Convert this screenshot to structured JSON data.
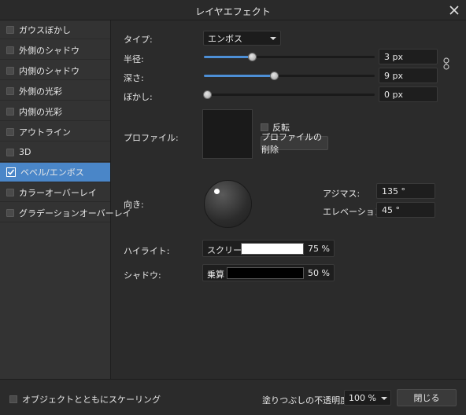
{
  "window": {
    "title": "レイヤエフェクト"
  },
  "sidebar": {
    "items": [
      {
        "label": "ガウスぼかし",
        "checked": false,
        "active": false
      },
      {
        "label": "外側のシャドウ",
        "checked": false,
        "active": false
      },
      {
        "label": "内側のシャドウ",
        "checked": false,
        "active": false
      },
      {
        "label": "外側の光彩",
        "checked": false,
        "active": false
      },
      {
        "label": "内側の光彩",
        "checked": false,
        "active": false
      },
      {
        "label": "アウトライン",
        "checked": false,
        "active": false
      },
      {
        "label": "3D",
        "checked": false,
        "active": false
      },
      {
        "label": "ベベル/エンボス",
        "checked": true,
        "active": true
      },
      {
        "label": "カラーオーバーレイ",
        "checked": false,
        "active": false
      },
      {
        "label": "グラデーションオーバーレイ",
        "checked": false,
        "active": false
      }
    ]
  },
  "panel": {
    "type_label": "タイプ:",
    "type_value": "エンボス",
    "radius_label": "半径:",
    "radius_value": "3 px",
    "radius_fraction": 0.28,
    "depth_label": "深さ:",
    "depth_value": "9 px",
    "depth_fraction": 0.41,
    "blur_label": "ぼかし:",
    "blur_value": "0 px",
    "blur_fraction": 0.02,
    "profile_label": "プロファイル:",
    "invert_label": "反転",
    "delete_profile_label": "プロファイルの削除",
    "direction_label": "向き:",
    "azimuth_label": "アジマス:",
    "azimuth_value": "135 °",
    "elevation_label": "エレベーション:",
    "elevation_value": "45 °",
    "highlight_label": "ハイライト:",
    "highlight_mode": "スクリーン",
    "highlight_pct": "75 %",
    "highlight_color": "#ffffff",
    "shadow_label": "シャドウ:",
    "shadow_mode": "乗算",
    "shadow_pct": "50 %",
    "shadow_color": "#000000"
  },
  "footer": {
    "scale_label": "オブジェクトとともにスケーリング",
    "opacity_label": "塗りつぶしの不透明度:",
    "opacity_value": "100 %",
    "close_label": "閉じる"
  },
  "colors": {
    "accent": "#4a86c8",
    "slider_fill": "#4d8fd6"
  }
}
